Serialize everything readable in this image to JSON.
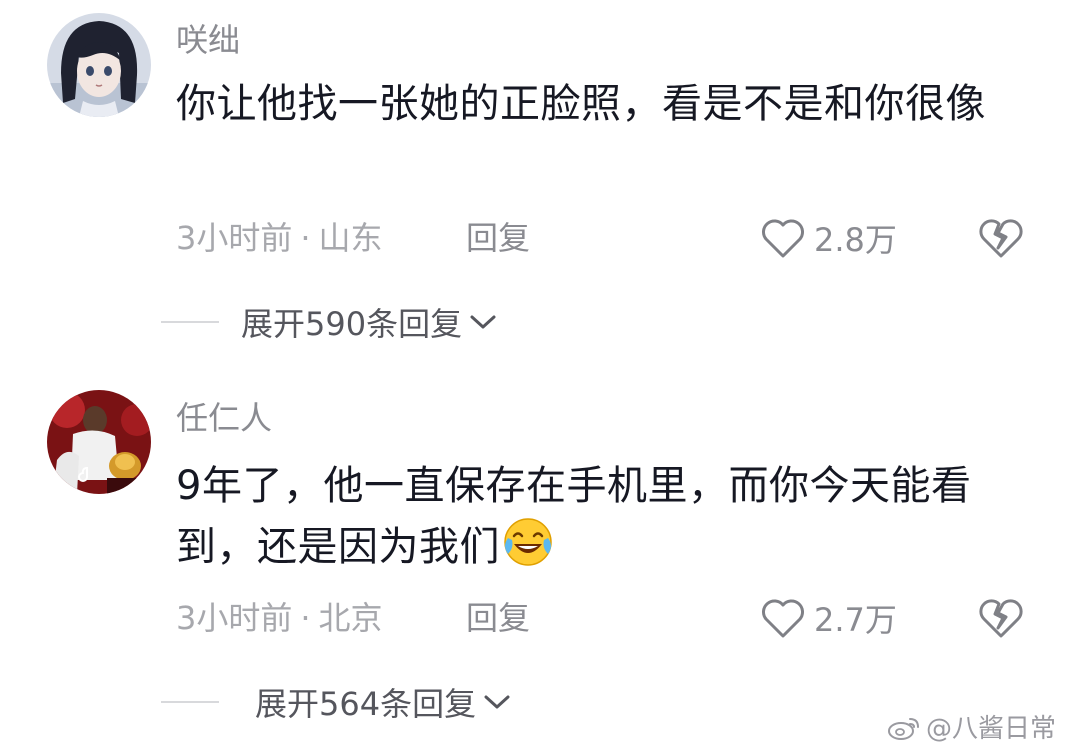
{
  "comments": [
    {
      "username": "咲绌",
      "text": "你让他找一张她的正脸照，看是不是和你很像",
      "time": "3小时前",
      "location": "山东",
      "reply_label": "回复",
      "likes": "2.8万",
      "expand_label": "展开590条回复"
    },
    {
      "username": "任仁人",
      "text": "9年了，他一直保存在手机里，而你今天能看到，还是因为我们",
      "time": "3小时前",
      "location": "北京",
      "reply_label": "回复",
      "likes": "2.7万",
      "expand_label": "展开564条回复"
    }
  ],
  "separator": "·",
  "watermark": "@八酱日常",
  "colors": {
    "text": "#161823",
    "secondary": "#8a8b91",
    "meta": "#a7a8ad",
    "icon": "#7f8086"
  }
}
